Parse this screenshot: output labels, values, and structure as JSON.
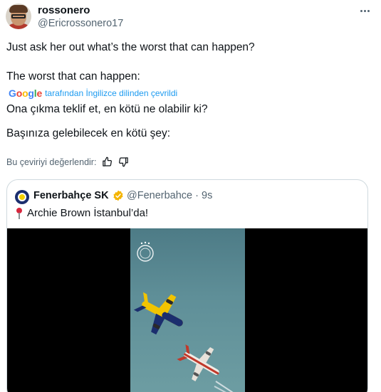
{
  "tweet": {
    "name": "rossonero",
    "handle": "@Ericrossonero17",
    "text_line1": "Just ask her out what’s the worst that can happen?",
    "text_line2": "The worst that can happen:",
    "translation": {
      "provider": "Google",
      "label": "tarafından İngilizce dilinden çevrildi",
      "line1": "Ona çıkma teklif et, en kötü ne olabilir ki?",
      "line2": "Başınıza gelebilecek en kötü şey:"
    },
    "rate_label": "Bu çeviriyi değerlendir:"
  },
  "quote": {
    "name": "Fenerbahçe SK",
    "handle": "@Fenerbahce",
    "separator": "·",
    "time": "9s",
    "text": "Archie Brown İstanbul’da!"
  },
  "colors": {
    "accent": "#1d9bf0",
    "verified": "#f4b400",
    "muted": "#536471"
  }
}
